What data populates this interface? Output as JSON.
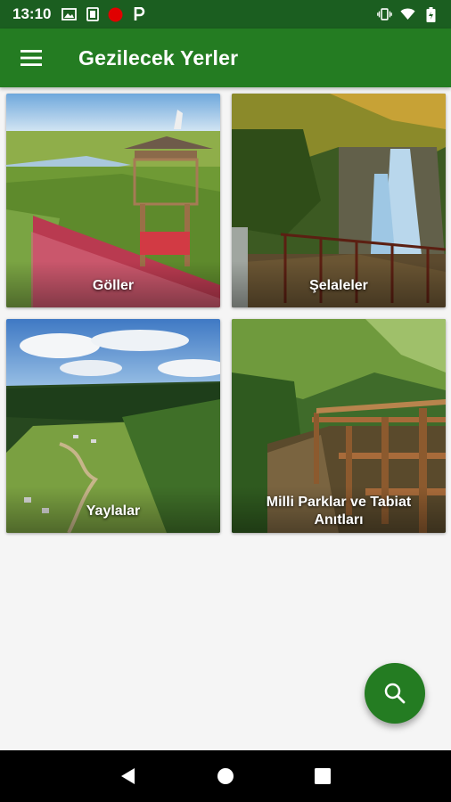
{
  "status_bar": {
    "time": "13:10",
    "icons_left": [
      "image-icon",
      "sim-icon",
      "record-icon",
      "parking-icon"
    ],
    "icons_right": [
      "vibrate-icon",
      "wifi-icon",
      "battery-icon"
    ]
  },
  "app_bar": {
    "title": "Gezilecek Yerler",
    "menu_icon": "hamburger-menu-icon"
  },
  "categories": [
    {
      "label": "Göller"
    },
    {
      "label": "Şelaleler"
    },
    {
      "label": "Yaylalar"
    },
    {
      "label_line1": "Milli Parklar ve Tabiat",
      "label_line2": "Anıtları"
    }
  ],
  "fab": {
    "icon": "search-icon",
    "color": "#247c22"
  },
  "colors": {
    "status_bar": "#1b5e20",
    "app_bar": "#247c22",
    "background": "#f5f5f5"
  },
  "nav_bar": {
    "icons": [
      "back-icon",
      "home-icon",
      "recents-icon"
    ]
  }
}
